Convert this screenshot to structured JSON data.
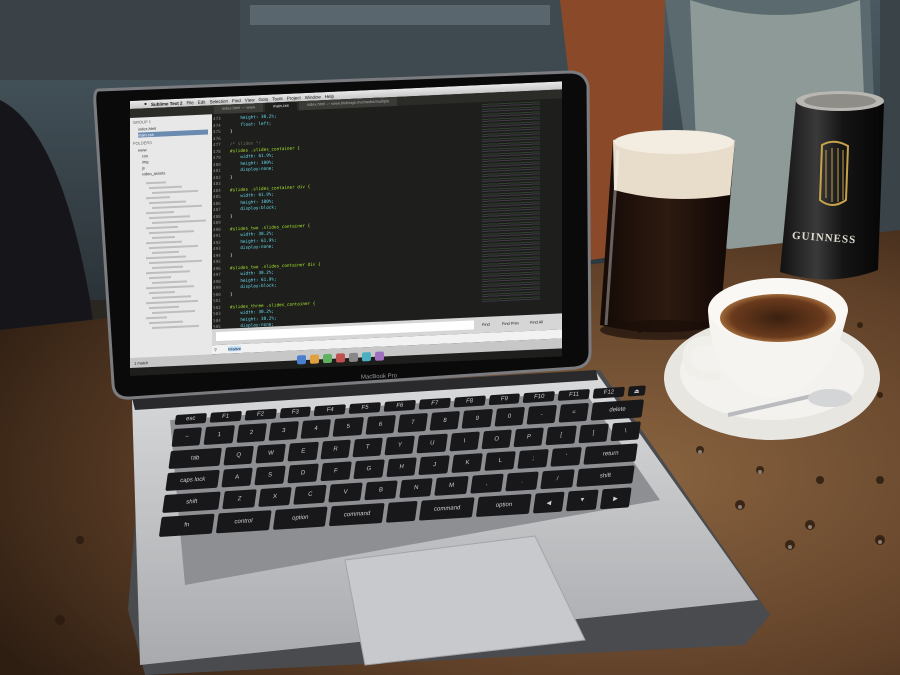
{
  "scene": {
    "description_free": true
  },
  "laptop": {
    "brand_label": "MacBook Pro",
    "menubar": {
      "app": "Sublime Text 2",
      "items": [
        "File",
        "Edit",
        "Selection",
        "Find",
        "View",
        "Goto",
        "Tools",
        "Project",
        "Window",
        "Help"
      ]
    },
    "tabs": [
      "index.html — www",
      "main.css",
      "index.html — www.tridesign.mx/media/multiple"
    ],
    "sidebar": {
      "header": "GROUP 1",
      "open_files": [
        "index.html",
        "main.css"
      ],
      "folders_label": "FOLDERS",
      "folders": [
        "www",
        "css",
        "img",
        "js",
        "video_assets"
      ]
    },
    "code": {
      "line_numbers": [
        "473",
        "474",
        "475",
        "476",
        "477",
        "478",
        "479",
        "480",
        "481",
        "482",
        "483",
        "484",
        "485",
        "486",
        "487",
        "488",
        "489",
        "490",
        "491",
        "492",
        "493",
        "494",
        "495",
        "496",
        "497",
        "498",
        "499",
        "500",
        "501",
        "502",
        "503",
        "504",
        "505",
        "506",
        "507"
      ],
      "lines": [
        "    height: 30.2%;",
        "    float: left;",
        "}",
        "",
        "/* slides */",
        "#slides .slides_container {",
        "    width: 61.9%;",
        "    height: 100%;",
        "    display:none;",
        "}",
        "",
        "#slides .slides_container div {",
        "    width: 61.9%;",
        "    height: 100%;",
        "    display:block;",
        "}",
        "",
        "#slides_two .slides_container {",
        "    width: 30.2%;",
        "    height: 61.9%;",
        "    display:none;",
        "}",
        "",
        "#slides_two .slides_container div {",
        "    width: 30.2%;",
        "    height: 61.9%;",
        "    display:block;",
        "}",
        "",
        "#slides_three .slides_container {",
        "    width: 30.2%;",
        "    height: 30.2%;",
        "    display:none;",
        "}",
        "#slides_three .slides_container div {"
      ]
    },
    "find_bar": {
      "input_value": "relative",
      "buttons": [
        "Find",
        "Find Prev",
        "Find All"
      ]
    },
    "status_bar": "1 match",
    "keyboard": {
      "rows": [
        [
          "esc",
          "F1",
          "F2",
          "F3",
          "F4",
          "F5",
          "F6",
          "F7",
          "F8",
          "F9",
          "F10",
          "F11",
          "F12",
          "⏏"
        ],
        [
          "~",
          "1",
          "2",
          "3",
          "4",
          "5",
          "6",
          "7",
          "8",
          "9",
          "0",
          "-",
          "=",
          "delete"
        ],
        [
          "tab",
          "Q",
          "W",
          "E",
          "R",
          "T",
          "Y",
          "U",
          "I",
          "O",
          "P",
          "[",
          "]",
          "\\"
        ],
        [
          "caps lock",
          "A",
          "S",
          "D",
          "F",
          "G",
          "H",
          "J",
          "K",
          "L",
          ";",
          "'",
          "return"
        ],
        [
          "shift",
          "Z",
          "X",
          "C",
          "V",
          "B",
          "N",
          "M",
          ",",
          ".",
          "/",
          "shift"
        ],
        [
          "fn",
          "control",
          "option",
          "command",
          "",
          "command",
          "option",
          "◀",
          "▼",
          "▶"
        ]
      ]
    }
  },
  "beer_can": {
    "brand": "GUINNESS"
  },
  "colors": {
    "table": "#6b4a2e",
    "screen_bg": "#1e1f1c",
    "keyword": "#f92672",
    "value": "#ae81ff",
    "property": "#66d9ef",
    "selector": "#a6e22e",
    "comment": "#75715e"
  }
}
